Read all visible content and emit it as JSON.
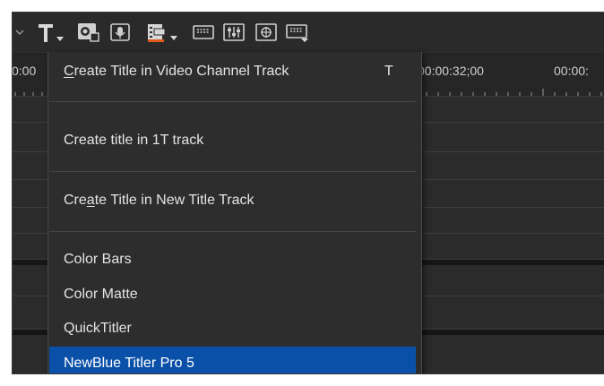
{
  "toolbar": {
    "icons": [
      {
        "name": "collapse-arrow-icon"
      },
      {
        "name": "title-text-icon"
      },
      {
        "name": "capture-device-icon"
      },
      {
        "name": "record-narration-icon"
      },
      {
        "name": "add-media-icon"
      },
      {
        "name": "keyboard-icon"
      },
      {
        "name": "audio-mixer-icon"
      },
      {
        "name": "effects-grid-icon"
      },
      {
        "name": "subtitle-keyboard-icon"
      }
    ],
    "accent_color": "#e05a1e"
  },
  "timeline": {
    "ruler_left_time": "0:00",
    "ruler_mid_time": "00:00:32;00",
    "ruler_right_time": "00:00:"
  },
  "menu": {
    "items": [
      {
        "pre": "",
        "mnemonic": "C",
        "post": "reate Title in Video Channel Track",
        "shortcut": "T"
      },
      {
        "pre": "Create title in 1T track",
        "mnemonic": "",
        "post": "",
        "shortcut": ""
      },
      {
        "pre": "Cre",
        "mnemonic": "a",
        "post": "te Title in New Title Track",
        "shortcut": ""
      },
      {
        "pre": "Color Bars",
        "mnemonic": "",
        "post": "",
        "shortcut": ""
      },
      {
        "pre": "Color Matte",
        "mnemonic": "",
        "post": "",
        "shortcut": ""
      },
      {
        "pre": "QuickTitler",
        "mnemonic": "",
        "post": "",
        "shortcut": ""
      },
      {
        "pre": "NewBlue Titler Pro 5",
        "mnemonic": "",
        "post": "",
        "shortcut": ""
      }
    ],
    "selected_index": 6,
    "selected_color": "#0b50a8"
  }
}
